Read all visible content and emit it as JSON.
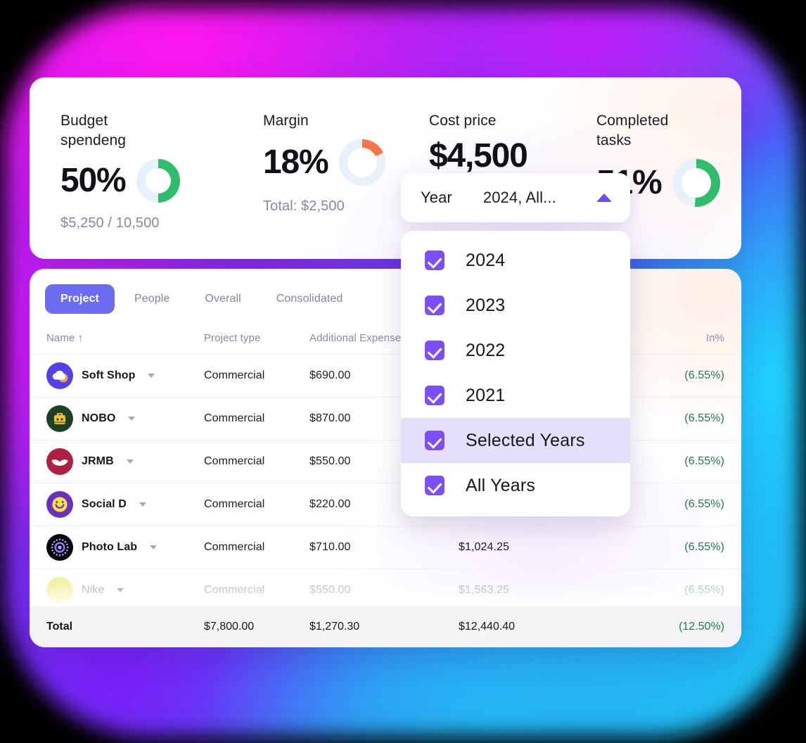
{
  "theme": {
    "accent_purple": "#6c6cf0",
    "checkbox_purple": "#7c4ef5",
    "highlight_row": "#e6dffb",
    "green": "#2fbd6b",
    "orange": "#f8744a",
    "track_blue": "#e6f1fa",
    "positive_text": "#1f7a4d"
  },
  "kpis": [
    {
      "title": "Budget spendeng",
      "value": "50%",
      "sub": "$5,250 / 10,500",
      "donut": {
        "percent": 50,
        "color": "#2fbd6b",
        "track": "#e6f1fa",
        "size": 62,
        "thickness": 13
      }
    },
    {
      "title": "Margin",
      "value": "18%",
      "sub": "Total: $2,500",
      "donut": {
        "percent": 18,
        "color": "#f8744a",
        "track": "#e6f1fa",
        "size": 66,
        "thickness": 12
      }
    },
    {
      "title": "Cost price",
      "value": "$4,500",
      "sub": "",
      "donut": null
    },
    {
      "title": "Completed tasks",
      "value": "51%",
      "sub": "",
      "donut": {
        "percent": 51,
        "color": "#2fbd6b",
        "track": "#e6f1fa",
        "size": 68,
        "thickness": 13
      }
    }
  ],
  "dropdown": {
    "label": "Year",
    "value": "2024, All...",
    "caret_icon": "chevron-up-icon",
    "expanded": true,
    "options": [
      {
        "label": "2024",
        "checked": true,
        "highlighted": false
      },
      {
        "label": "2023",
        "checked": true,
        "highlighted": false
      },
      {
        "label": "2022",
        "checked": true,
        "highlighted": false
      },
      {
        "label": "2021",
        "checked": true,
        "highlighted": false
      },
      {
        "label": "Selected Years",
        "checked": true,
        "highlighted": true
      },
      {
        "label": "All Years",
        "checked": true,
        "highlighted": false
      }
    ]
  },
  "table": {
    "tabs": [
      {
        "label": "Project",
        "active": true
      },
      {
        "label": "People",
        "active": false
      },
      {
        "label": "Overall",
        "active": false
      },
      {
        "label": "Consolidated",
        "active": false
      }
    ],
    "columns": [
      {
        "key": "name",
        "label": "Name",
        "sort_icon": "arrow-up-icon"
      },
      {
        "key": "type",
        "label": "Project type"
      },
      {
        "key": "expenses",
        "label": "Additional Expenses"
      },
      {
        "key": "cost",
        "label": ""
      },
      {
        "key": "inp",
        "label": "In%"
      }
    ],
    "rows": [
      {
        "name": "Soft Shop",
        "type": "Commercial",
        "expenses": "$690.00",
        "cost": "",
        "inp": "(6.55%)",
        "faded": false,
        "avatar": {
          "icon": "cloud-icon",
          "bg": "#5340e8",
          "fg": "#ffffff",
          "accent": "#f5a23c"
        }
      },
      {
        "name": "NOBO",
        "type": "Commercial",
        "expenses": "$870.00",
        "cost": "",
        "inp": "(6.55%)",
        "faded": false,
        "avatar": {
          "icon": "toolbox-icon",
          "bg": "#1e4027",
          "fg": "#f4c02c",
          "accent": "#f4c02c"
        }
      },
      {
        "name": "JRMB",
        "type": "Commercial",
        "expenses": "$550.00",
        "cost": "",
        "inp": "(6.55%)",
        "faded": false,
        "avatar": {
          "icon": "moustache-icon",
          "bg": "#af1f41",
          "fg": "#ffffff",
          "accent": "#ffffff"
        }
      },
      {
        "name": "Social D",
        "type": "Commercial",
        "expenses": "$220.00",
        "cost": "",
        "inp": "(6.55%)",
        "faded": false,
        "avatar": {
          "icon": "smiley-icon",
          "bg": "#6b2fc4",
          "fg": "#f2e53a",
          "accent": "#6b2fc4"
        }
      },
      {
        "name": "Photo Lab",
        "type": "Commercial",
        "expenses": "$710.00",
        "cost": "$1,024.25",
        "inp": "(6.55%)",
        "faded": false,
        "avatar": {
          "icon": "aperture-icon",
          "bg": "#050509",
          "fg": "#8d7bf0",
          "accent": "#b9a8ff"
        }
      },
      {
        "name": "Nike",
        "type": "Commercial",
        "expenses": "$550.00",
        "cost": "$1,563.25",
        "inp": "(6.55%)",
        "faded": true,
        "avatar": {
          "icon": "blank-icon",
          "bg": "#f2ef9a",
          "fg": "#f2ef9a",
          "accent": "#f8f6c8"
        }
      }
    ],
    "total": {
      "label": "Total",
      "type": "$7,800.00",
      "expenses": "$1,270.30",
      "cost": "$12,440.40",
      "inp": "(12.50%)"
    }
  }
}
